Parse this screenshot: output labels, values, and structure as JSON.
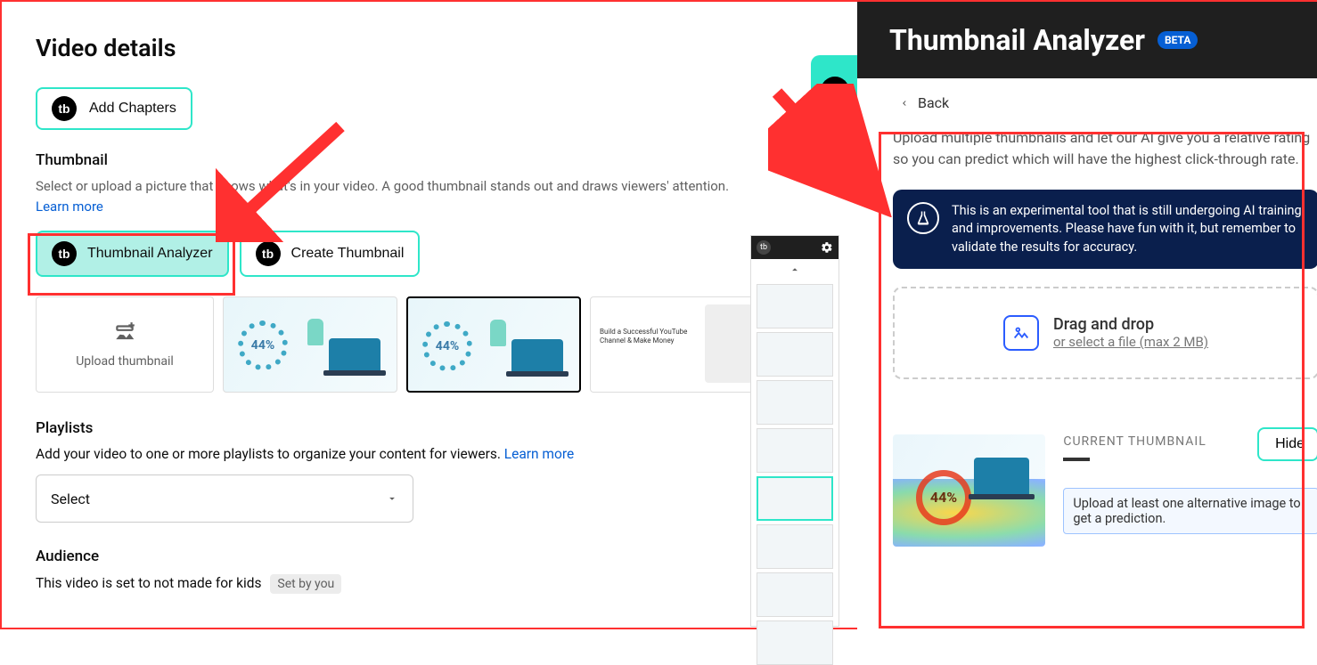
{
  "left": {
    "title": "Video details",
    "add_chapters": "Add Chapters",
    "thumbnail_section": "Thumbnail",
    "thumbnail_help": "Select or upload a picture that shows what's in your video. A good thumbnail stands out and draws viewers' attention.",
    "learn_more": "Learn more",
    "analyzer_btn": "Thumbnail Analyzer",
    "create_btn": "Create Thumbnail",
    "upload_thumb": "Upload thumbnail",
    "ring_pct": "44%",
    "playlists_section": "Playlists",
    "playlists_help": "Add your video to one or more playlists to organize your content for viewers. ",
    "playlists_learn": "Learn more",
    "select_value": "Select",
    "audience_section": "Audience",
    "audience_note": "This video is set to not made for kids",
    "set_by": "Set by you"
  },
  "right": {
    "title": "Thumbnail Analyzer",
    "beta": "BETA",
    "back": "Back",
    "description": "Upload multiple thumbnails and let our AI give you a relative rating so you can predict which will have the highest click-through rate.",
    "notice": "This is an experimental tool that is still undergoing AI training and improvements. Please have fun with it, but remember to validate the results for accuracy.",
    "drop_title": "Drag and drop",
    "drop_sub": "or select a file (max 2 MB)",
    "hide": "Hide",
    "current_label": "CURRENT THUMBNAIL",
    "heat_pct": "44%",
    "warn": "Upload at least one alternative image to get a prediction."
  }
}
